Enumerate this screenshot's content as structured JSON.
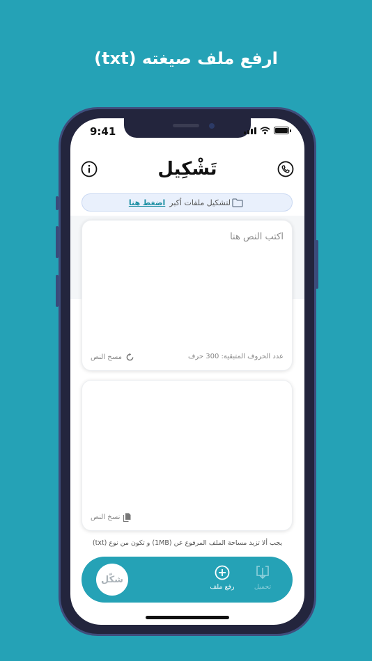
{
  "headline": "ارفع ملف صيغته (txt)",
  "status_bar": {
    "time": "9:41"
  },
  "app": {
    "logo": "تَشْكِيل",
    "info_icon": "info-icon",
    "phone_icon": "phone-icon"
  },
  "banner": {
    "text": "لتشكيل ملفات أكبر",
    "link": "اضغط هنا",
    "icon": "folder-icon"
  },
  "input_card": {
    "placeholder": "اكتب النص هنا",
    "remaining_chars": "عدد الحروف المتبقية: 300 حرف",
    "clear_label": "مسح النص",
    "clear_icon": "refresh-icon"
  },
  "output_card": {
    "copy_label": "نسخ النص",
    "copy_icon": "copy-icon"
  },
  "note": "يجب ألا تزيد مساحة الملف المرفوع عن (1MB) و تكون من نوع (txt)",
  "bottom_bar": {
    "shakkil_label": "شكّل",
    "upload_label": "رفع ملف",
    "upload_icon": "plus-circle-icon",
    "download_label": "تحميل",
    "download_icon": "download-icon"
  },
  "colors": {
    "background": "#25a2b6",
    "accent": "#25a2b6",
    "link": "#1d8fa3",
    "banner_bg": "#e9f0fc"
  }
}
